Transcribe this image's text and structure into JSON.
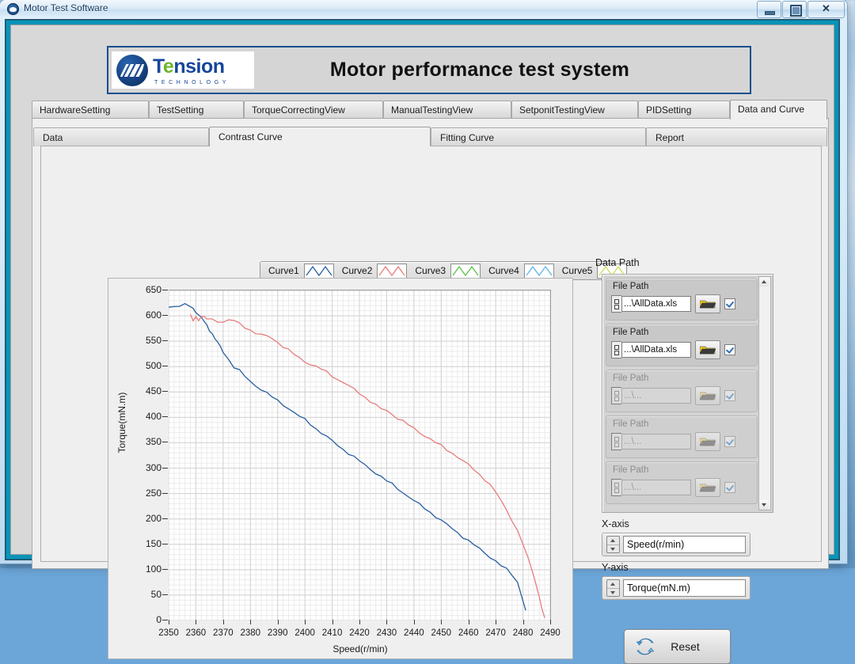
{
  "window": {
    "title": "Motor Test Software",
    "icon": "app-icon",
    "buttons": {
      "minimize": "minimize",
      "maximize": "maximize",
      "close": "✕"
    }
  },
  "banner": {
    "logo_name": "Tension",
    "logo_letters": {
      "t": "T",
      "e": "e",
      "rest": "nsion"
    },
    "logo_subtitle": "TECHNOLOGY",
    "title": "Motor performance test system"
  },
  "main_tabs": [
    {
      "label": "HardwareSetting",
      "active": false
    },
    {
      "label": "TestSetting",
      "active": false
    },
    {
      "label": "TorqueCorrectingView",
      "active": false
    },
    {
      "label": "ManualTestingView",
      "active": false
    },
    {
      "label": "SetponitTestingView",
      "active": false
    },
    {
      "label": "PIDSetting",
      "active": false
    },
    {
      "label": "Data and Curve",
      "active": true
    }
  ],
  "sub_tabs": [
    {
      "label": "Data",
      "active": false
    },
    {
      "label": "Contrast Curve",
      "active": true
    },
    {
      "label": "Fitting Curve",
      "active": false
    },
    {
      "label": "Report",
      "active": false
    }
  ],
  "legend": {
    "items": [
      {
        "label": "Curve1",
        "color": "#2a5fa0"
      },
      {
        "label": "Curve2",
        "color": "#e97c7c"
      },
      {
        "label": "Curve3",
        "color": "#5cc24a"
      },
      {
        "label": "Curve4",
        "color": "#5bb7ea"
      },
      {
        "label": "Curve5",
        "color": "#c9dd5a"
      }
    ]
  },
  "data_path": {
    "section_label": "Data Path",
    "rows": [
      {
        "label": "File Path",
        "value": "...\\AllData.xls",
        "enabled": true,
        "checked": true,
        "browse_icon": "folder-open-icon"
      },
      {
        "label": "File Path",
        "value": "...\\AllData.xls",
        "enabled": true,
        "checked": true,
        "browse_icon": "folder-open-icon"
      },
      {
        "label": "File Path",
        "value": "...\\...",
        "enabled": false,
        "checked": true,
        "browse_icon": "folder-open-icon"
      },
      {
        "label": "File Path",
        "value": "...\\...",
        "enabled": false,
        "checked": true,
        "browse_icon": "folder-open-icon"
      },
      {
        "label": "File Path",
        "value": "...\\...",
        "enabled": false,
        "checked": true,
        "browse_icon": "folder-open-icon"
      }
    ]
  },
  "axis_controls": {
    "x_label": "X-axis",
    "x_value": "Speed(r/min)",
    "y_label": "Y-axis",
    "y_value": "Torque(mN.m)"
  },
  "reset": {
    "label": "Reset",
    "icon": "refresh-icon"
  },
  "chart_data": {
    "type": "line",
    "title": "",
    "xlabel": "Speed(r/min)",
    "ylabel": "Torque(mN.m)",
    "xlim": [
      2350,
      2490
    ],
    "ylim": [
      0,
      650
    ],
    "xticks": [
      2350,
      2360,
      2370,
      2380,
      2390,
      2400,
      2410,
      2420,
      2430,
      2440,
      2450,
      2460,
      2470,
      2480,
      2490
    ],
    "yticks": [
      0,
      50,
      100,
      150,
      200,
      250,
      300,
      350,
      400,
      450,
      500,
      550,
      600,
      650
    ],
    "grid": true,
    "legend_position": "top",
    "series": [
      {
        "name": "Curve1",
        "color": "#2a5fa0",
        "x": [
          2350,
          2352,
          2354,
          2356,
          2358,
          2359,
          2360,
          2361,
          2362,
          2363,
          2364,
          2365,
          2366,
          2367,
          2368,
          2369,
          2370,
          2372,
          2374,
          2376,
          2378,
          2380,
          2382,
          2384,
          2386,
          2388,
          2390,
          2392,
          2394,
          2396,
          2398,
          2400,
          2402,
          2404,
          2406,
          2408,
          2410,
          2412,
          2414,
          2416,
          2418,
          2420,
          2422,
          2424,
          2426,
          2428,
          2430,
          2432,
          2434,
          2436,
          2438,
          2440,
          2442,
          2444,
          2446,
          2448,
          2450,
          2452,
          2454,
          2456,
          2458,
          2460,
          2462,
          2464,
          2466,
          2468,
          2470,
          2472,
          2474,
          2476,
          2478,
          2480,
          2481
        ],
        "y": [
          617,
          619,
          621,
          622,
          618,
          613,
          608,
          603,
          597,
          589,
          580,
          572,
          565,
          556,
          547,
          538,
          529,
          514,
          500,
          492,
          480,
          470,
          462,
          456,
          448,
          440,
          432,
          425,
          418,
          410,
          402,
          395,
          387,
          378,
          370,
          362,
          353,
          345,
          337,
          330,
          322,
          314,
          306,
          298,
          291,
          283,
          275,
          268,
          260,
          252,
          244,
          236,
          228,
          221,
          213,
          205,
          197,
          189,
          181,
          173,
          165,
          157,
          149,
          141,
          133,
          125,
          117,
          108,
          100,
          90,
          76,
          40,
          20
        ]
      },
      {
        "name": "Curve2",
        "color": "#e97c7c",
        "x": [
          2358,
          2359,
          2360,
          2361,
          2362,
          2363,
          2364,
          2366,
          2368,
          2370,
          2372,
          2374,
          2376,
          2378,
          2380,
          2382,
          2384,
          2386,
          2388,
          2390,
          2392,
          2394,
          2396,
          2398,
          2400,
          2402,
          2404,
          2406,
          2408,
          2410,
          2412,
          2414,
          2416,
          2418,
          2420,
          2422,
          2424,
          2426,
          2428,
          2430,
          2432,
          2434,
          2436,
          2438,
          2440,
          2442,
          2444,
          2446,
          2448,
          2450,
          2452,
          2454,
          2456,
          2458,
          2460,
          2462,
          2464,
          2466,
          2468,
          2470,
          2472,
          2474,
          2476,
          2478,
          2480,
          2482,
          2484,
          2486,
          2487,
          2488
        ],
        "y": [
          600,
          590,
          598,
          592,
          600,
          597,
          594,
          592,
          590,
          588,
          592,
          590,
          584,
          578,
          572,
          566,
          562,
          560,
          556,
          548,
          540,
          532,
          524,
          517,
          510,
          505,
          500,
          495,
          489,
          482,
          475,
          469,
          462,
          455,
          448,
          440,
          432,
          424,
          416,
          414,
          406,
          399,
          392,
          385,
          378,
          371,
          364,
          357,
          350,
          344,
          337,
          330,
          322,
          314,
          306,
          298,
          288,
          278,
          266,
          252,
          236,
          218,
          198,
          176,
          150,
          120,
          88,
          48,
          22,
          5
        ]
      }
    ]
  }
}
